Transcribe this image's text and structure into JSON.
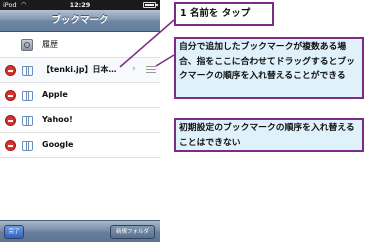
{
  "statusbar": {
    "carrier": "iPod",
    "time": "12:29"
  },
  "navbar": {
    "title": "ブックマーク"
  },
  "rows": [
    {
      "label": "履歴"
    },
    {
      "label": "【tenki.jp】日本…"
    },
    {
      "label": "Apple"
    },
    {
      "label": "Yahoo!"
    },
    {
      "label": "Google"
    }
  ],
  "toolbar": {
    "done_label": "完了",
    "new_folder_label": "新規フォルダ"
  },
  "annotations": {
    "step": "1 名前を タップ",
    "note_drag": "自分で追加したブックマークが複数ある場合、指をここに合わせてドラッグするとブックマークの順序を入れ替えることができる",
    "note_default": "初期設定のブックマークの順序を入れ替えることはできない"
  },
  "colors": {
    "accent": "#7b2c84",
    "note_bg": "#dff1fb",
    "delete": "#d9312c",
    "navbar": "#6d86a4"
  }
}
